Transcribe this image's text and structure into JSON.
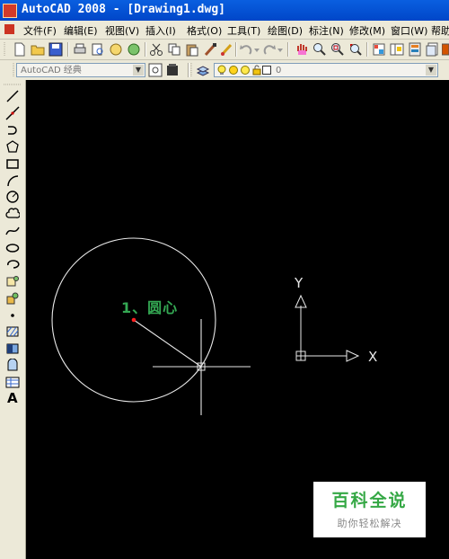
{
  "window": {
    "title": "AutoCAD 2008 - [Drawing1.dwg]"
  },
  "menu": [
    {
      "label": "文件(F)"
    },
    {
      "label": "编辑(E)"
    },
    {
      "label": "视图(V)"
    },
    {
      "label": "插入(I)"
    },
    {
      "label": "格式(O)"
    },
    {
      "label": "工具(T)"
    },
    {
      "label": "绘图(D)"
    },
    {
      "label": "标注(N)"
    },
    {
      "label": "修改(M)"
    },
    {
      "label": "窗口(W)"
    },
    {
      "label": "帮助"
    }
  ],
  "toolbar2": {
    "workspace": "AutoCAD 经典",
    "layer_value": "0"
  },
  "canvas": {
    "annotation": "1、圆心",
    "ucs_x": "X",
    "ucs_y": "Y"
  },
  "watermark": {
    "title": "百科全说",
    "subtitle": "助你轻松解决"
  },
  "colors": {
    "annotation": "#34a853",
    "center_point": "#ff2020",
    "drawing": "#ffffff"
  }
}
